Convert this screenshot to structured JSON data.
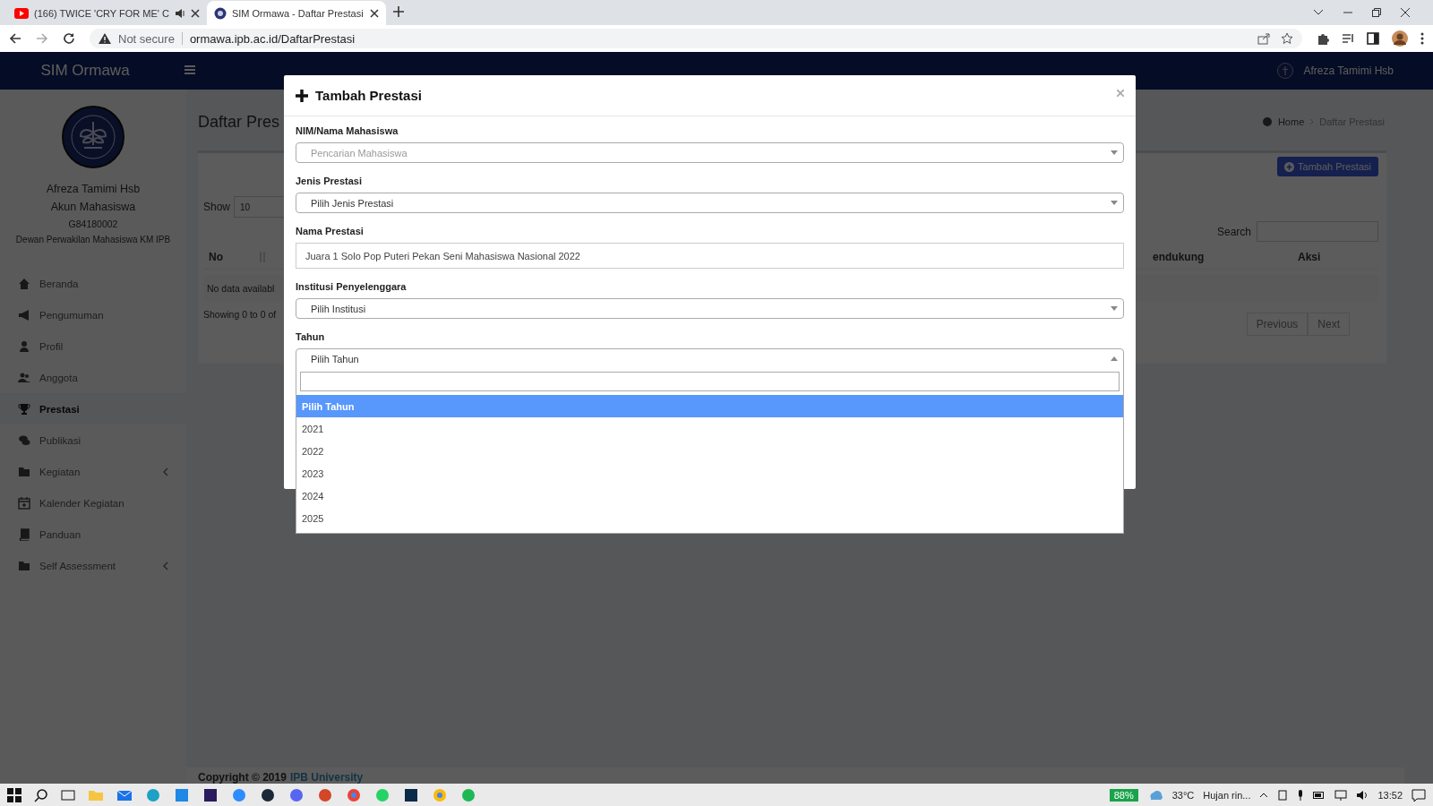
{
  "browser": {
    "tabs": [
      {
        "title": "(166) TWICE 'CRY FOR ME' C",
        "kind": "video",
        "audio": true,
        "selected": false
      },
      {
        "title": "SIM Ormawa - Daftar Prestasi",
        "kind": "site",
        "audio": false,
        "selected": true
      }
    ],
    "address": {
      "security": "Not secure",
      "url": "ormawa.ipb.ac.id/DaftarPrestasi"
    }
  },
  "header": {
    "brand": "SIM Ormawa",
    "user": "Afreza Tamimi Hsb"
  },
  "sidebar": {
    "profile": {
      "name": "Afreza Tamimi Hsb",
      "role": "Akun Mahasiswa",
      "nim": "G84180002",
      "organization": "Dewan Perwakilan Mahasiswa KM IPB"
    },
    "items": [
      {
        "label": "Beranda",
        "selected": false,
        "submenu": false
      },
      {
        "label": "Pengumuman",
        "selected": false,
        "submenu": false
      },
      {
        "label": "Profil",
        "selected": false,
        "submenu": false
      },
      {
        "label": "Anggota",
        "selected": false,
        "submenu": false
      },
      {
        "label": "Prestasi",
        "selected": true,
        "submenu": false
      },
      {
        "label": "Publikasi",
        "selected": false,
        "submenu": false
      },
      {
        "label": "Kegiatan",
        "selected": false,
        "submenu": true
      },
      {
        "label": "Kalender Kegiatan",
        "selected": false,
        "submenu": false
      },
      {
        "label": "Panduan",
        "selected": false,
        "submenu": false
      },
      {
        "label": "Self Assessment",
        "selected": false,
        "submenu": true
      }
    ]
  },
  "page": {
    "title": "Daftar Pres",
    "breadcrumb": [
      "Home",
      "Daftar Prestasi"
    ],
    "add_button": "Tambah Prestasi",
    "show_label": "Show",
    "show_value": "10",
    "search_label": "Search",
    "columns": [
      "No",
      "endukung",
      "Aksi"
    ],
    "empty_text": "No data availabl",
    "info": "Showing 0 to 0 of",
    "pagination": [
      "Previous",
      "Next"
    ]
  },
  "footer": {
    "text": "Copyright © 2019",
    "link": "IPB University"
  },
  "modal": {
    "title": "Tambah Prestasi",
    "fields": [
      {
        "label": "NIM/Nama Mahasiswa",
        "kind": "select",
        "text": "Pencarian Mahasiswa",
        "muted": true,
        "open": false
      },
      {
        "label": "Jenis Prestasi",
        "kind": "select",
        "text": "Pilih Jenis Prestasi",
        "muted": false,
        "open": false
      },
      {
        "label": "Nama Prestasi",
        "kind": "input",
        "text": "Juara 1 Solo Pop Puteri Pekan Seni Mahasiswa Nasional 2022"
      },
      {
        "label": "Institusi Penyelenggara",
        "kind": "select",
        "text": "Pilih Institusi",
        "muted": false,
        "open": false
      },
      {
        "label": "Tahun",
        "kind": "select",
        "text": "Pilih Tahun",
        "muted": false,
        "open": true
      }
    ],
    "dropdown": [
      {
        "label": "Pilih Tahun",
        "selected": true
      },
      {
        "label": "2021",
        "selected": false
      },
      {
        "label": "2022",
        "selected": false
      },
      {
        "label": "2023",
        "selected": false
      },
      {
        "label": "2024",
        "selected": false
      },
      {
        "label": "2025",
        "selected": false
      }
    ]
  },
  "taskbar": {
    "battery": "88%",
    "temperature": "33°C",
    "weather": "Hujan rin...",
    "time": "13:52"
  }
}
